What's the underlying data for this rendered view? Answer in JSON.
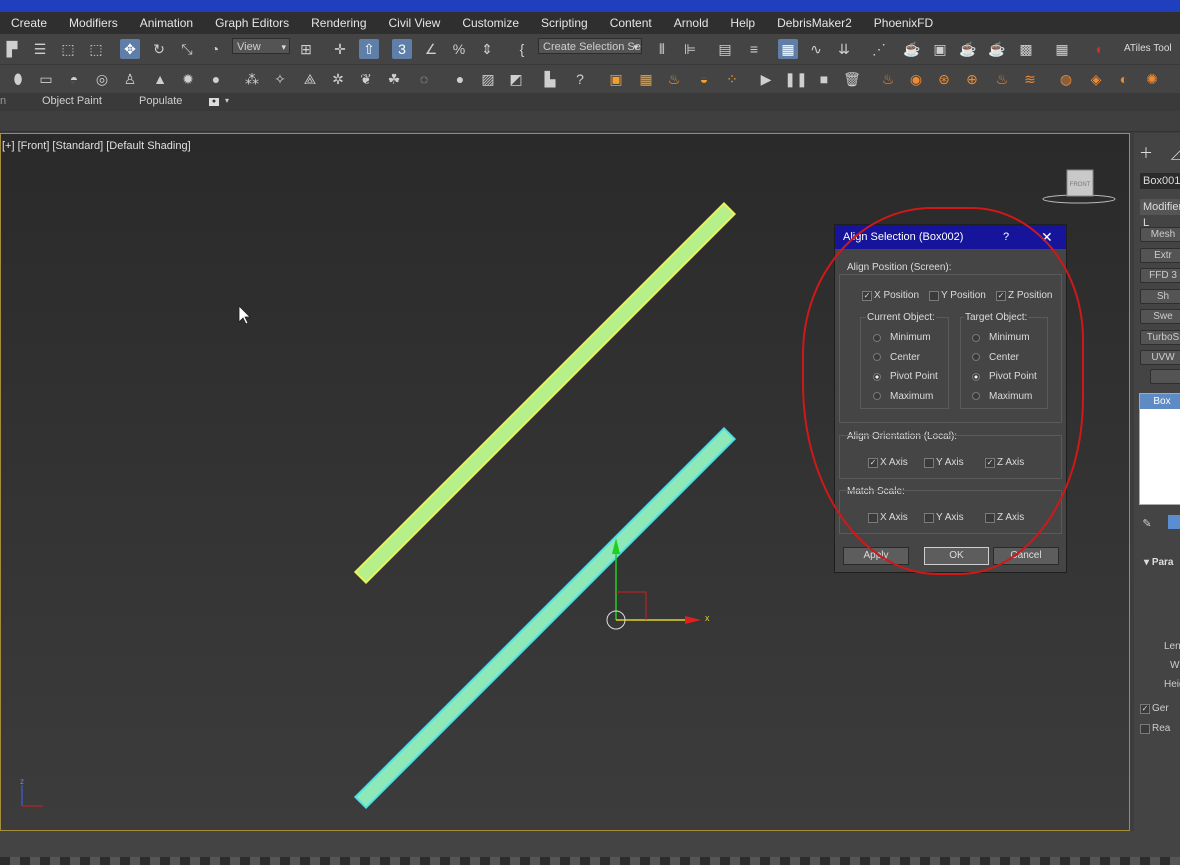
{
  "menubar": {
    "items": [
      "Create",
      "Modifiers",
      "Animation",
      "Graph Editors",
      "Rendering",
      "Civil View",
      "Customize",
      "Scripting",
      "Content",
      "Arnold",
      "Help",
      "DebrisMaker2",
      "PhoenixFD"
    ]
  },
  "toolbar": {
    "view_dropdown": "View",
    "selection_set_dropdown": "Create Selection Se",
    "snap_label": "3",
    "atiles_label": "ATiles Tool"
  },
  "ribbon": {
    "object_paint": "Object Paint",
    "populate": "Populate"
  },
  "viewport": {
    "label": "[+] [Front] [Standard] [Default Shading]",
    "viewcube_label": "FRONT",
    "gizmo_x": "x",
    "axis_z": "z"
  },
  "dialog": {
    "title": "Align Selection (Box002)",
    "help": "?",
    "close": "✕",
    "align_position_label": "Align Position (Screen):",
    "x_position": "X Position",
    "y_position": "Y Position",
    "z_position": "Z Position",
    "x_position_checked": true,
    "y_position_checked": false,
    "z_position_checked": true,
    "current_object_label": "Current Object:",
    "target_object_label": "Target Object:",
    "current_options": [
      "Minimum",
      "Center",
      "Pivot Point",
      "Maximum"
    ],
    "target_options": [
      "Minimum",
      "Center",
      "Pivot Point",
      "Maximum"
    ],
    "current_selected": "Pivot Point",
    "target_selected": "Pivot Point",
    "align_orientation_label": "Align Orientation (Local):",
    "orient_x": "X Axis",
    "orient_y": "Y Axis",
    "orient_z": "Z Axis",
    "orient_x_checked": true,
    "orient_y_checked": false,
    "orient_z_checked": true,
    "match_scale_label": "Match Scale:",
    "scale_x": "X Axis",
    "scale_y": "Y Axis",
    "scale_z": "Z Axis",
    "apply": "Apply",
    "ok": "OK",
    "cancel": "Cancel"
  },
  "right_panel": {
    "object_name": "Box001",
    "modifier_list": "Modifier L",
    "buttons": [
      "Mesh",
      "Extr",
      "FFD 3",
      "Sh",
      "Swe",
      "TurboS",
      "UVW"
    ],
    "stack_item": "Box",
    "params_label": "Para",
    "length": "Leng",
    "width": "Wid",
    "height": "Heig",
    "gen": "Ger",
    "real": "Rea"
  },
  "colors": {
    "box001": "#b6f08a",
    "box001_outline": "#ecf25a",
    "box002": "#8ee8b8",
    "box002_outline": "#4fe0e6",
    "dialog_title": "#16149a",
    "annotation": "#d01818"
  }
}
